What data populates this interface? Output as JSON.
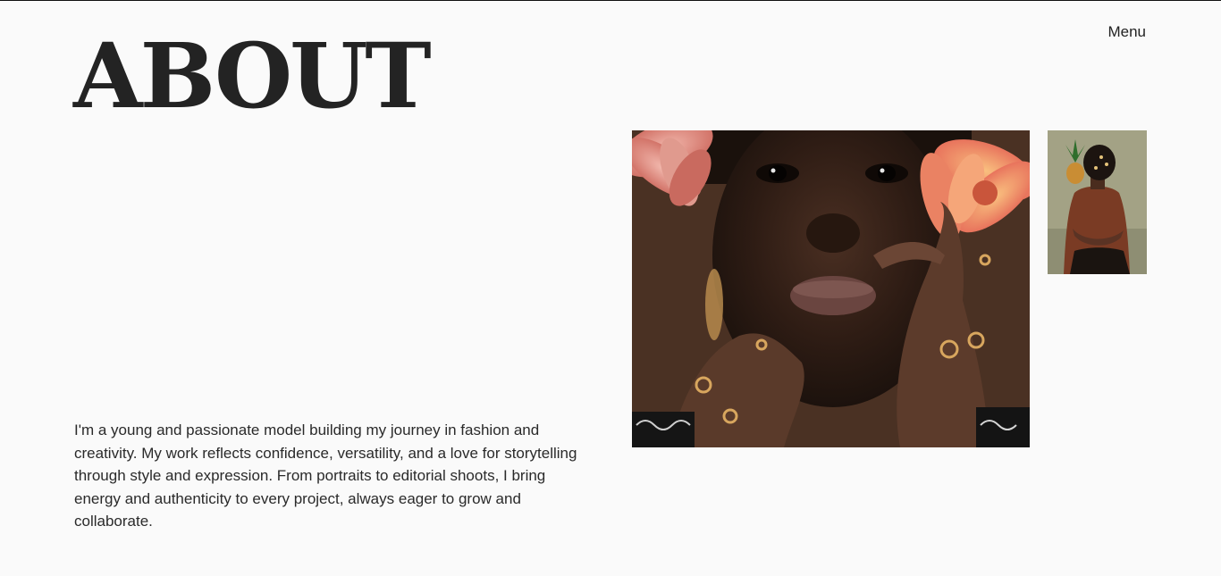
{
  "header": {
    "title": "ABOUT",
    "menu_label": "Menu"
  },
  "bio": {
    "text": "I'm a young and passionate model building my journey in fashion and creativity. My work reflects confidence, versatility, and a love for storytelling through style and expression. From portraits to editorial shoots, I bring energy and authenticity to every project, always eager to grow and collaborate."
  },
  "colors": {
    "background": "#fafafa",
    "text": "#222222"
  }
}
